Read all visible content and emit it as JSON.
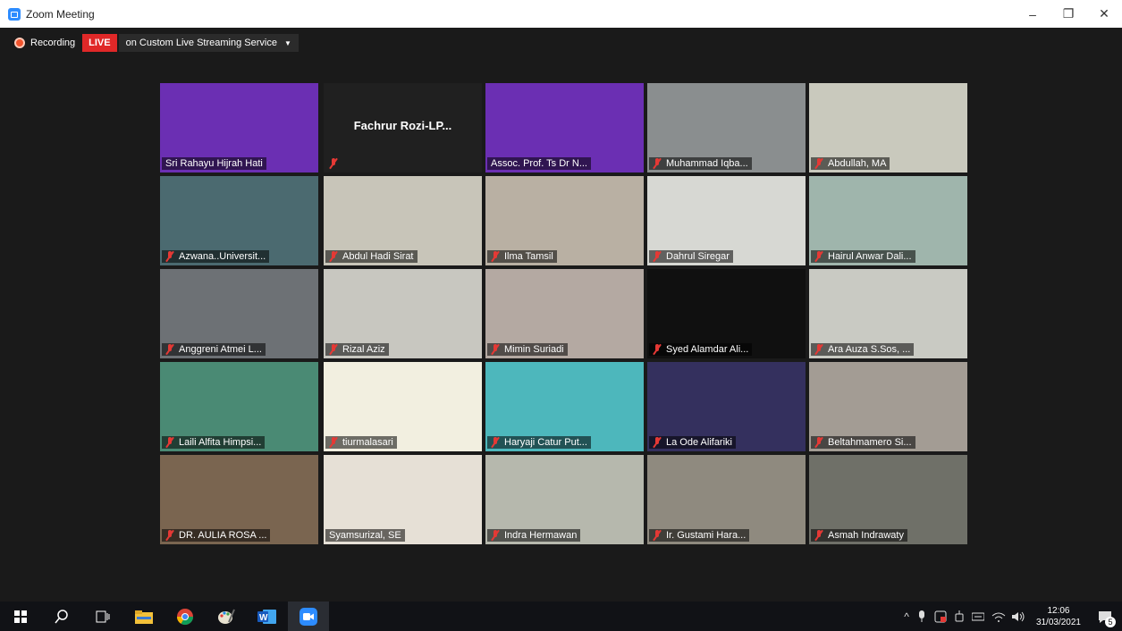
{
  "window": {
    "title": "Zoom Meeting",
    "minimize": "–",
    "restore": "❐",
    "close": "✕"
  },
  "recording": {
    "label": "Recording",
    "live_badge": "LIVE",
    "stream_label": "on Custom Live Streaming Service"
  },
  "participants": [
    {
      "name": "Sri Rahayu Hijrah Hati",
      "muted": false,
      "active": true,
      "bg": "#6b2fb3"
    },
    {
      "name": "",
      "center_name": "Fachrur Rozi-LP...",
      "muted": true,
      "bg": "#202020"
    },
    {
      "name": "Assoc. Prof. Ts Dr N...",
      "muted": false,
      "bg": "#6b2fb3"
    },
    {
      "name": "Muhammad Iqba...",
      "muted": true,
      "bg": "#8a8e8f"
    },
    {
      "name": "Abdullah, MA",
      "muted": true,
      "bg": "#c9c9bd"
    },
    {
      "name": "Azwana..Universit...",
      "muted": true,
      "bg": "#4b6a70"
    },
    {
      "name": "Abdul Hadi Sirat",
      "muted": true,
      "bg": "#c8c5b9"
    },
    {
      "name": "Ilma Tamsil",
      "muted": true,
      "bg": "#b9b0a3"
    },
    {
      "name": "Dahrul Siregar",
      "muted": true,
      "bg": "#d7d8d3"
    },
    {
      "name": "Hairul Anwar Dali...",
      "muted": true,
      "bg": "#9fb5ac"
    },
    {
      "name": "Anggreni Atmei L...",
      "muted": true,
      "bg": "#6d7175"
    },
    {
      "name": "Rizal Aziz",
      "muted": true,
      "bg": "#c8c7c0"
    },
    {
      "name": "Mimin Suriadi",
      "muted": true,
      "bg": "#b4a9a2"
    },
    {
      "name": "Syed Alamdar Ali...",
      "muted": true,
      "bg": "#101010"
    },
    {
      "name": "Ara Auza S.Sos, ...",
      "muted": true,
      "bg": "#c9cac3"
    },
    {
      "name": "Laili Alfita Himpsi...",
      "muted": true,
      "bg": "#4a8a74"
    },
    {
      "name": "tiurmalasari",
      "muted": true,
      "bg": "#f2efe0"
    },
    {
      "name": "Haryaji Catur Put...",
      "muted": true,
      "bg": "#4db7bc"
    },
    {
      "name": "La Ode Alifariki",
      "muted": true,
      "bg": "#34305e"
    },
    {
      "name": "Beltahmamero Si...",
      "muted": true,
      "bg": "#a39c94"
    },
    {
      "name": "DR. AULIA ROSA ...",
      "muted": true,
      "bg": "#7a6550"
    },
    {
      "name": "Syamsurizal, SE",
      "muted": false,
      "bg": "#e6e0d6"
    },
    {
      "name": "Indra Hermawan",
      "muted": true,
      "bg": "#b6b8ad"
    },
    {
      "name": "Ir. Gustami Hara...",
      "muted": true,
      "bg": "#8f8a7f"
    },
    {
      "name": "Asmah Indrawaty",
      "muted": true,
      "bg": "#6f7068"
    }
  ],
  "taskbar": {
    "icons": [
      "windows-start-icon",
      "search-icon",
      "task-view-icon",
      "file-explorer-icon",
      "chrome-icon",
      "paint-icon",
      "word-icon",
      "zoom-icon"
    ],
    "tray_caret": "^",
    "time": "12:06",
    "date": "31/03/2021",
    "notification_count": "5"
  }
}
